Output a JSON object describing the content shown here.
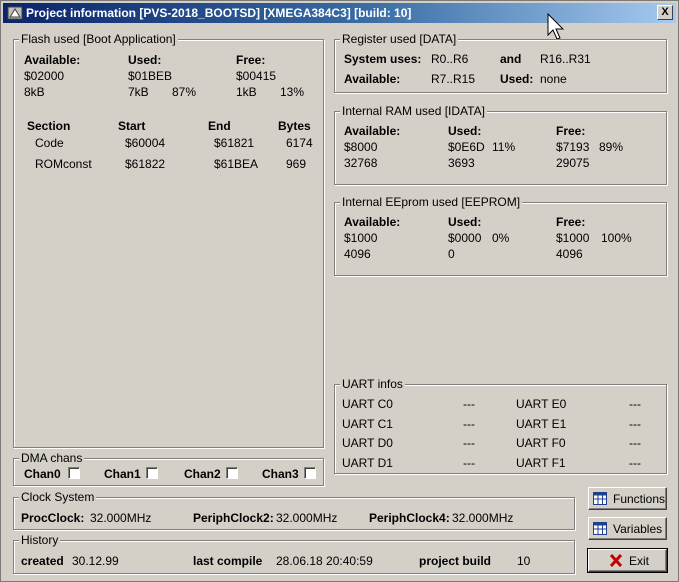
{
  "window": {
    "title": "Project information [PVS-2018_BOOTSD] [XMEGA384C3] [build: 10]",
    "close_label": "X"
  },
  "flash": {
    "legend": "Flash used [Boot Application]",
    "available_label": "Available:",
    "used_label": "Used:",
    "free_label": "Free:",
    "available_hex": "$02000",
    "available_size": "8kB",
    "used_hex": "$01BEB",
    "used_size": "7kB",
    "used_pct": "87%",
    "free_hex": "$00415",
    "free_size": "1kB",
    "free_pct": "13%",
    "sections": {
      "headers": [
        "Section",
        "Start",
        "End",
        "Bytes"
      ],
      "rows": [
        [
          "Code",
          "$60004",
          "$61821",
          "6174"
        ],
        [
          "ROMconst",
          "$61822",
          "$61BEA",
          "969"
        ]
      ]
    }
  },
  "registers": {
    "legend": "Register used [DATA]",
    "system_uses_label": "System uses:",
    "system_uses_value": "R0..R6",
    "and_label": "and",
    "and_value": "R16..R31",
    "available_label": "Available:",
    "available_value": "R7..R15",
    "used_label": "Used:",
    "used_value": "none"
  },
  "ram": {
    "legend": "Internal RAM used [IDATA]",
    "available_label": "Available:",
    "used_label": "Used:",
    "free_label": "Free:",
    "available_hex": "$8000",
    "available_dec": "32768",
    "used_hex": "$0E6D",
    "used_pct": "11%",
    "used_dec": "3693",
    "free_hex": "$7193",
    "free_pct": "89%",
    "free_dec": "29075"
  },
  "eeprom": {
    "legend": "Internal EEprom used [EEPROM]",
    "available_label": "Available:",
    "used_label": "Used:",
    "free_label": "Free:",
    "available_hex": "$1000",
    "available_dec": "4096",
    "used_hex": "$0000",
    "used_pct": "0%",
    "used_dec": "0",
    "free_hex": "$1000",
    "free_pct": "100%",
    "free_dec": "4096"
  },
  "uart": {
    "legend": "UART infos",
    "rows": [
      {
        "left": "UART C0",
        "left_val": "---",
        "right": "UART E0",
        "right_val": "---"
      },
      {
        "left": "UART C1",
        "left_val": "---",
        "right": "UART E1",
        "right_val": "---"
      },
      {
        "left": "UART D0",
        "left_val": "---",
        "right": "UART F0",
        "right_val": "---"
      },
      {
        "left": "UART D1",
        "left_val": "---",
        "right": "UART F1",
        "right_val": "---"
      }
    ]
  },
  "dma": {
    "legend": "DMA chans",
    "channels": [
      {
        "label": "Chan0",
        "checked": false
      },
      {
        "label": "Chan1",
        "checked": false
      },
      {
        "label": "Chan2",
        "checked": false
      },
      {
        "label": "Chan3",
        "checked": false
      }
    ]
  },
  "clock": {
    "legend": "Clock System",
    "proc_label": "ProcClock:",
    "proc_value": "32.000MHz",
    "periph2_label": "PeriphClock2:",
    "periph2_value": "32.000MHz",
    "periph4_label": "PeriphClock4:",
    "periph4_value": "32.000MHz"
  },
  "history": {
    "legend": "History",
    "created_label": "created",
    "created_value": "30.12.99",
    "last_compile_label": "last compile",
    "last_compile_value": "28.06.18 20:40:59",
    "build_label": "project build",
    "build_value": "10"
  },
  "buttons": {
    "functions": "Functions",
    "variables": "Variables",
    "exit": "Exit"
  },
  "colors": {
    "face": "#d4d0c8",
    "title_start": "#0a246a",
    "title_end": "#a6caf0",
    "exit_x": "#c00000"
  }
}
